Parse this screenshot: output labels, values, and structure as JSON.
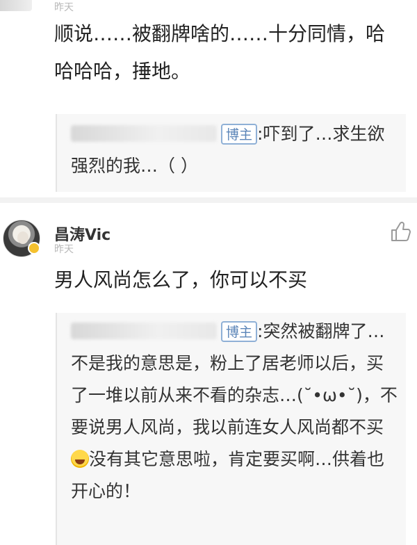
{
  "comments": [
    {
      "time": "昨天",
      "body": "顺说……被翻牌啥的……十分同情，哈哈哈哈，捶地。",
      "reply": {
        "badge": "博主",
        "text": ":吓到了…求生欲强烈的我…（ ）"
      }
    },
    {
      "username": "昌涛Vic",
      "time": "昨天",
      "body": "男人风尚怎么了，你可以不买",
      "reply": {
        "badge": "博主",
        "text_before_emoji": ":突然被翻牌了…不是我的意思是，粉上了居老师以后，买了一堆以前从来不看的杂志…(˘•ω•˘)，不要说男人风尚，我以前连女人风尚都不买",
        "text_after_emoji": "没有其它意思啦，肯定要买啊…供着也开心的！"
      }
    }
  ],
  "colors": {
    "badge_text": "#5b85b8",
    "badge_border": "#8fb0d6",
    "vip": "#f5c12e",
    "divider": "#f2f2f2",
    "reply_bg": "#f7f7f7"
  },
  "icons": [
    "like-icon",
    "laughing-emoji-icon",
    "vip-badge-icon"
  ]
}
